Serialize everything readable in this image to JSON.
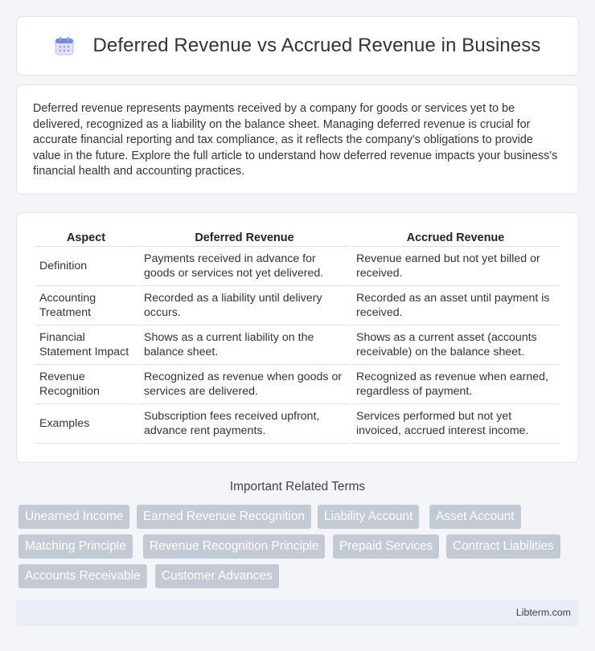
{
  "header": {
    "title": "Deferred Revenue vs Accrued Revenue in Business",
    "icon": "calendar-icon"
  },
  "intro": {
    "text": "Deferred revenue represents payments received by a company for goods or services yet to be delivered, recognized as a liability on the balance sheet. Managing deferred revenue is crucial for accurate financial reporting and tax compliance, as it reflects the company's obligations to provide value in the future. Explore the full article to understand how deferred revenue impacts your business's financial health and accounting practices."
  },
  "table": {
    "headers": [
      "Aspect",
      "Deferred Revenue",
      "Accrued Revenue"
    ],
    "rows": [
      [
        "Definition",
        "Payments received in advance for goods or services not yet delivered.",
        "Revenue earned but not yet billed or received."
      ],
      [
        "Accounting Treatment",
        "Recorded as a liability until delivery occurs.",
        "Recorded as an asset until payment is received."
      ],
      [
        "Financial Statement Impact",
        "Shows as a current liability on the balance sheet.",
        "Shows as a current asset (accounts receivable) on the balance sheet."
      ],
      [
        "Revenue Recognition",
        "Recognized as revenue when goods or services are delivered.",
        "Recognized as revenue when earned, regardless of payment."
      ],
      [
        "Examples",
        "Subscription fees received upfront, advance rent payments.",
        "Services performed but not yet invoiced, accrued interest income."
      ]
    ]
  },
  "related": {
    "title": "Important Related Terms",
    "terms": [
      "Unearned Income",
      "Earned Revenue Recognition",
      "Liability Account",
      "Asset Account",
      "Matching Principle",
      "Revenue Recognition Principle",
      "Prepaid Services",
      "Contract Liabilities",
      "Accounts Receivable",
      "Customer Advances"
    ]
  },
  "footer": {
    "site": "Libterm.com"
  },
  "colors": {
    "background": "#f3f5f8",
    "tag_bg": "#c4cad3",
    "footer_bg": "#e9edf6"
  }
}
